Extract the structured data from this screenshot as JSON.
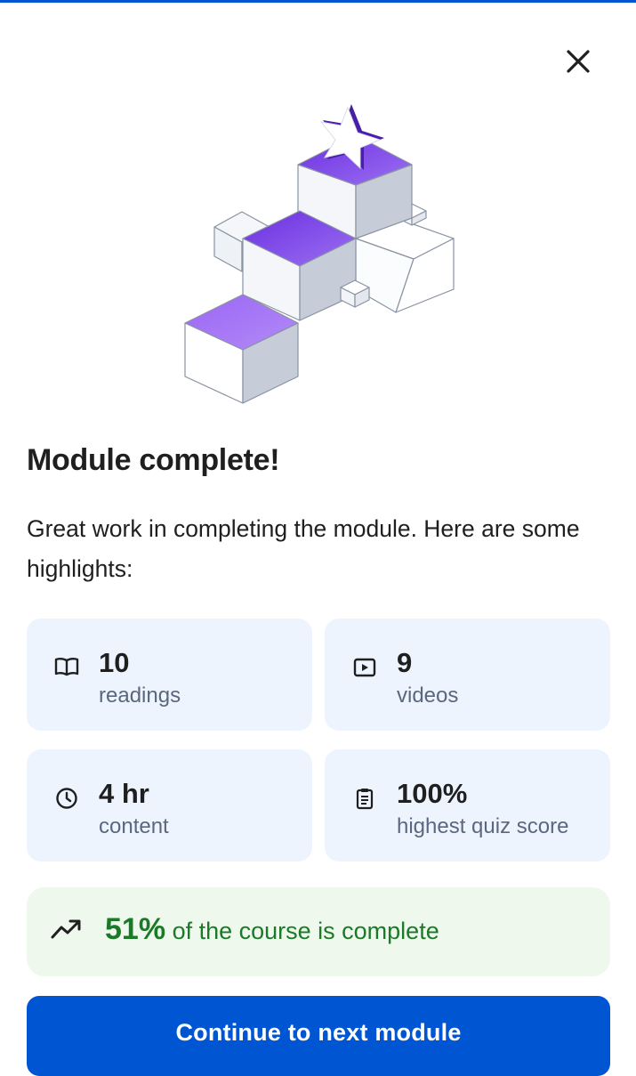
{
  "header": {
    "close_icon": "close-icon"
  },
  "hero": {
    "illustration": "stacked-cubes-with-star"
  },
  "title": "Module complete!",
  "description": "Great work in completing the module. Here are some highlights:",
  "stats": [
    {
      "icon": "book-icon",
      "value": "10",
      "label": "readings"
    },
    {
      "icon": "video-icon",
      "value": "9",
      "label": "videos"
    },
    {
      "icon": "clock-icon",
      "value": "4 hr",
      "label": "content"
    },
    {
      "icon": "clipboard-icon",
      "value": "100%",
      "label": "highest quiz score"
    }
  ],
  "progress": {
    "icon": "trending-up-icon",
    "percent": "51%",
    "text": " of the course is complete"
  },
  "cta": {
    "label": "Continue to next module"
  },
  "colors": {
    "accent": "#0056d2",
    "card_bg": "#eef4fd",
    "success_bg": "#eef8ec",
    "success_text": "#1b7a28",
    "purple": "#7b3fe4"
  }
}
